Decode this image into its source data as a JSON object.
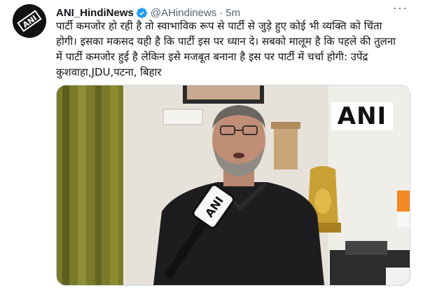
{
  "tweet": {
    "display_name": "ANI_HindiNews",
    "handle": "@AHindinews",
    "separator": "·",
    "time": "5m",
    "more_label": "···",
    "text": "पार्टी कमजोर हो रही है तो स्वाभाविक रूप से पार्टी से जुड़े हुए कोई भी व्यक्ति को चिंता\nहोगी। इसका मकसद यही है कि पार्टी इस पर ध्यान दे। सबको मालूम है कि पहले की तुलना\nमें पार्टी कमजोर हुई है लेकिन इसे मजबूत बनाना है इस पर पार्टी में चर्चा होगी: उपेंद्र\nकुशवाहा,JDU,पटना, बिहार",
    "media": {
      "watermark": "ANI",
      "mic_logo": "ANI"
    },
    "verified_color": "#1d9bf0",
    "avatar_icon": "ani-logo-icon"
  }
}
